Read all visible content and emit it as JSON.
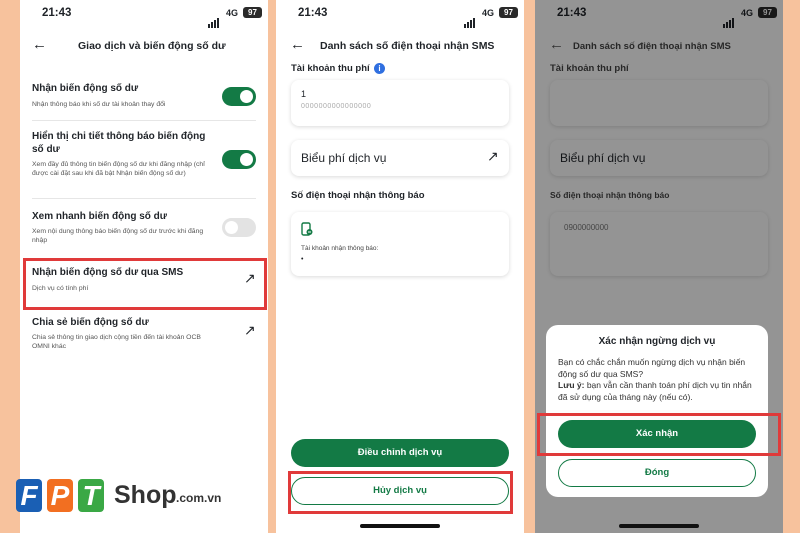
{
  "status_bar": {
    "time": "21:43",
    "network": "4G",
    "battery": "97"
  },
  "screen1": {
    "title": "Giao dịch và biến động số dư",
    "rows": [
      {
        "title": "Nhận biến động số dư",
        "subtitle": "Nhận thông báo khi số dư tài khoản thay đổi",
        "control": "toggle-on"
      },
      {
        "title": "Hiển thị chi tiết thông báo biến động số dư",
        "subtitle": "Xem đầy đủ thông tin biến động số dư khi đăng nhập (chỉ được cài đặt sau khi đã bật Nhận biến động số dư)",
        "control": "toggle-on"
      },
      {
        "title": "Xem nhanh biến động số dư",
        "subtitle": "Xem nội dung thông báo biến động số dư trước khi đăng nhập",
        "control": "toggle-off"
      },
      {
        "title": "Nhận biến động số dư qua SMS",
        "subtitle": "Dịch vụ có tính phí",
        "control": "arrow"
      },
      {
        "title": "Chia sẻ biến động số dư",
        "subtitle": "Chia sẻ thông tin giao dịch cộng tiền đến tài khoản OCB OMNI khác",
        "control": "arrow"
      }
    ]
  },
  "screen2": {
    "title": "Danh sách số điện thoại nhận SMS",
    "fee_account_label": "Tài khoản thu phí",
    "account_name": "1",
    "account_number": "0000000000000000",
    "fee_schedule": "Biểu phí dịch vụ",
    "phone_section_label": "Số điện thoại nhận thông báo",
    "notify_account_label": "Tài khoản nhận thông báo:",
    "notify_account_value": "•",
    "adjust_button": "Điều chỉnh dịch vụ",
    "cancel_button": "Hủy dịch vụ"
  },
  "screen3": {
    "bg_title": "Danh sách số điện thoại nhận SMS",
    "bg_fee_account_label": "Tài khoản thu phí",
    "bg_fee_schedule": "Biểu phí dịch vụ",
    "bg_phone_section_label": "Số điện thoại nhận thông báo",
    "bg_phone": "0900000000",
    "dialog_title": "Xác nhận ngừng dịch vụ",
    "dialog_question": "Bạn có chắc chắn muốn ngừng dịch vụ nhận biến động số dư qua SMS?",
    "note_label": "Lưu ý:",
    "note_text": " bạn vẫn cần thanh toán phí dịch vụ tin nhắn đã sử dụng của tháng này (nếu có).",
    "confirm_button": "Xác nhận",
    "close_button": "Đóng"
  },
  "brand": {
    "letters": [
      "F",
      "P",
      "T"
    ],
    "shop": "Shop",
    "domain": ".com.vn"
  },
  "colors": {
    "accent_green": "#137a45",
    "highlight_red": "#e03a3a",
    "background_peach": "#f7c29d",
    "fpt_blue": "#1a5fb4",
    "fpt_orange": "#f26f21",
    "fpt_green": "#3aa845"
  }
}
